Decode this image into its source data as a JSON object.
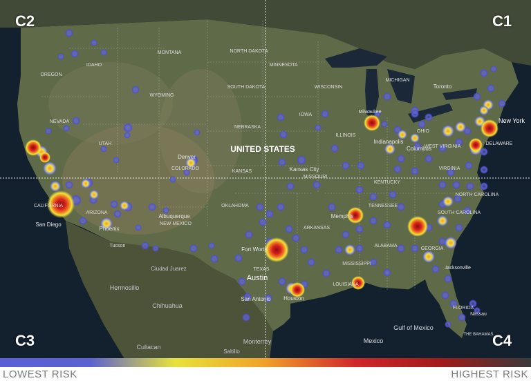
{
  "quadrants": {
    "c1": "C1",
    "c2": "C2",
    "c3": "C3",
    "c4": "C4"
  },
  "legend": {
    "low_label": "LOWEST RISK",
    "high_label": "HIGHEST RISK",
    "gradient_colors": [
      "#5b5fd6",
      "#5c62d0",
      "#e7e23a",
      "#f0a02a",
      "#d0262a",
      "#a11a1a",
      "#3a3a3a"
    ]
  },
  "map_labels": {
    "country": "UNITED STATES",
    "gulf": "Gulf of Mexico",
    "mexico": "Mexico",
    "bahamas": "THE BAHAMAS",
    "nassau": "Nassau",
    "toronto": "Toronto",
    "new_york": "New York",
    "memphis": "Memphis",
    "kansas_city": "Kansas City",
    "phoenix": "Phoenix",
    "albuquerque": "Albuquerque",
    "san_diego": "San Diego",
    "fort_worth": "Fort Worth",
    "austin": "Austin",
    "san_antonio": "San Antonio",
    "houston": "Houston",
    "jacksonville": "Jacksonville",
    "milwaukee": "Milwaukee",
    "columbus": "Columbus",
    "indianapolis": "Indianapolis",
    "denver": "Denver",
    "tucson": "Tucson",
    "hermosillo": "Hermosillo",
    "chihuahua": "Chihuahua",
    "ciudad_juarez": "Ciudad Juarez",
    "monterrey": "Monterrey",
    "saltillo": "Saltillo",
    "culiacan": "Culiacan",
    "states": [
      "MONTANA",
      "NORTH DAKOTA",
      "SOUTH DAKOTA",
      "MINNESOTA",
      "WISCONSIN",
      "MICHIGAN",
      "IOWA",
      "NEBRASKA",
      "ILLINOIS",
      "OHIO",
      "KANSAS",
      "MISSOURI",
      "KENTUCKY",
      "VIRGINIA",
      "WEST VIRGINIA",
      "TENNESSEE",
      "NORTH CAROLINA",
      "SOUTH CAROLINA",
      "ARKANSAS",
      "OKLAHOMA",
      "ALABAMA",
      "GEORGIA",
      "MISSISSIPPI",
      "LOUISIANA",
      "TEXAS",
      "NEW MEXICO",
      "ARIZONA",
      "COLORADO",
      "UTAH",
      "NEVADA",
      "WYOMING",
      "IDAHO",
      "OREGON",
      "FLORIDA",
      "CALIFORNIA",
      "DELAWARE"
    ]
  },
  "hotspot_levels": [
    {
      "city": "Los Angeles",
      "level": "highest"
    },
    {
      "city": "San Francisco",
      "level": "highest"
    },
    {
      "city": "Dallas / Fort Worth",
      "level": "highest"
    },
    {
      "city": "Memphis",
      "level": "highest"
    },
    {
      "city": "Chicago",
      "level": "highest"
    },
    {
      "city": "Atlanta",
      "level": "highest"
    },
    {
      "city": "New York",
      "level": "highest"
    },
    {
      "city": "Philadelphia",
      "level": "high"
    },
    {
      "city": "Houston",
      "level": "high"
    },
    {
      "city": "New Orleans",
      "level": "high"
    },
    {
      "city": "Phoenix",
      "level": "medium"
    },
    {
      "city": "Denver",
      "level": "medium"
    },
    {
      "city": "Indianapolis",
      "level": "medium"
    },
    {
      "city": "Charlotte",
      "level": "medium"
    },
    {
      "city": "Jacksonville",
      "level": "medium"
    },
    {
      "city": "Savannah",
      "level": "medium"
    }
  ]
}
